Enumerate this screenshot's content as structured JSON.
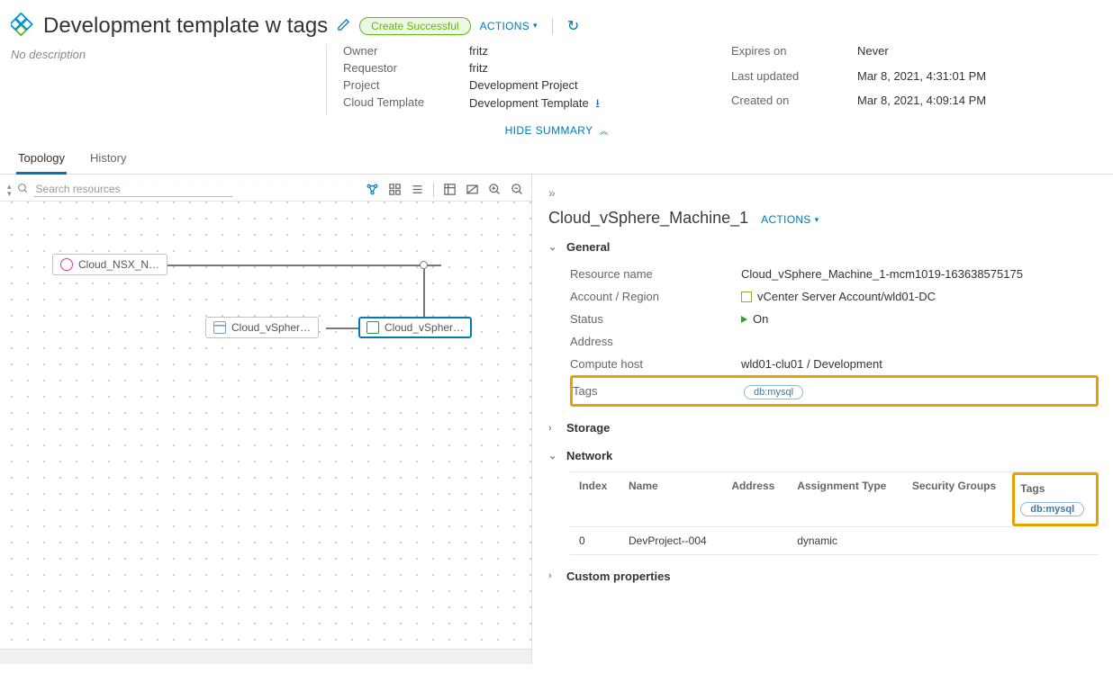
{
  "header": {
    "title": "Development template w tags",
    "create_status": "Create Successful",
    "actions_label": "ACTIONS"
  },
  "summary": {
    "no_description": "No description",
    "left": {
      "owner_k": "Owner",
      "owner_v": "fritz",
      "requestor_k": "Requestor",
      "requestor_v": "fritz",
      "project_k": "Project",
      "project_v": "Development Project",
      "template_k": "Cloud Template",
      "template_v": "Development Template"
    },
    "right": {
      "expires_k": "Expires on",
      "expires_v": "Never",
      "updated_k": "Last updated",
      "updated_v": "Mar 8, 2021, 4:31:01 PM",
      "created_k": "Created on",
      "created_v": "Mar 8, 2021, 4:09:14 PM"
    },
    "hide_label": "HIDE SUMMARY"
  },
  "tabs": {
    "topology": "Topology",
    "history": "History"
  },
  "canvas": {
    "search_placeholder": "Search resources",
    "nodes": {
      "nsx": "Cloud_NSX_N…",
      "db": "Cloud_vSpher…",
      "vm": "Cloud_vSpher…"
    }
  },
  "details": {
    "title": "Cloud_vSphere_Machine_1",
    "actions_label": "ACTIONS",
    "sections": {
      "general": "General",
      "storage": "Storage",
      "network": "Network",
      "custom": "Custom properties"
    },
    "general": {
      "resource_k": "Resource name",
      "resource_v": "Cloud_vSphere_Machine_1-mcm1019-163638575175",
      "account_k": "Account / Region",
      "account_v": "vCenter Server Account/wld01-DC",
      "status_k": "Status",
      "status_v": "On",
      "address_k": "Address",
      "compute_k": "Compute host",
      "compute_v": "wld01-clu01 / Development",
      "tags_k": "Tags",
      "tags_v": "db:mysql"
    },
    "network_table": {
      "headers": {
        "index": "Index",
        "name": "Name",
        "address": "Address",
        "assignment": "Assignment Type",
        "security": "Security Groups",
        "tags": "Tags"
      },
      "row0": {
        "index": "0",
        "name": "DevProject--004",
        "address": "",
        "assignment": "dynamic",
        "security": "",
        "tag": "db:mysql"
      }
    }
  }
}
